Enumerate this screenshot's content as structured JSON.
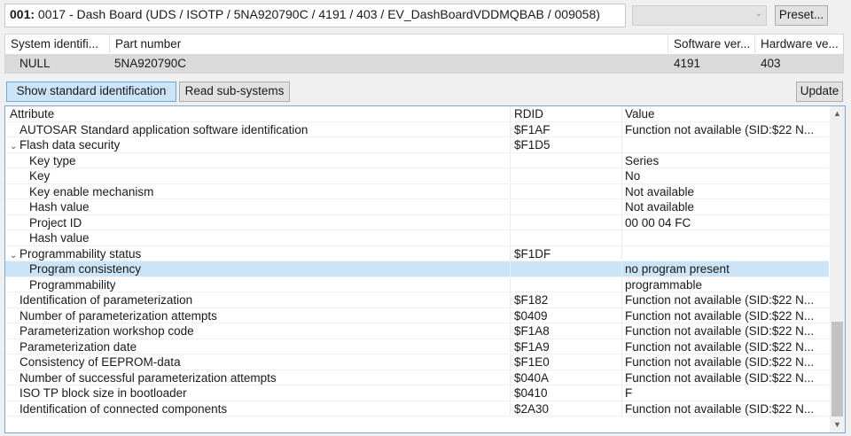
{
  "header": {
    "ecu_number": "001:",
    "ecu_title": " 0017 - Dash Board  (UDS / ISOTP / 5NA920790C / 4191 / 403 / EV_DashBoardVDDMQBAB / 009058)",
    "preset_label": "Preset..."
  },
  "ident_table": {
    "columns": [
      "System identifi...",
      "Part number",
      "Software ver...",
      "Hardware ve..."
    ],
    "row": [
      "NULL",
      "5NA920790C",
      "4191",
      "403"
    ]
  },
  "toolbar": {
    "show_standard_label": "Show standard identification",
    "read_subsystems_label": "Read sub-systems",
    "update_label": "Update"
  },
  "attributes": {
    "columns": [
      "Attribute",
      "RDID",
      "Value"
    ],
    "rows": [
      {
        "name": "AUTOSAR Standard application software identification",
        "rdid": "$F1AF",
        "value": "Function not available (SID:$22 N..."
      },
      {
        "name": "Flash data security",
        "rdid": "$F1D5",
        "value": ""
      },
      {
        "name": "Key type",
        "rdid": "",
        "value": "Series"
      },
      {
        "name": "Key",
        "rdid": "",
        "value": "No"
      },
      {
        "name": "Key enable mechanism",
        "rdid": "",
        "value": "Not available"
      },
      {
        "name": "Hash value",
        "rdid": "",
        "value": "Not available"
      },
      {
        "name": "Project ID",
        "rdid": "",
        "value": "00 00 04 FC"
      },
      {
        "name": "Hash value",
        "rdid": "",
        "value": ""
      },
      {
        "name": "Programmability status",
        "rdid": "$F1DF",
        "value": ""
      },
      {
        "name": "Program consistency",
        "rdid": "",
        "value": "no program present"
      },
      {
        "name": "Programmability",
        "rdid": "",
        "value": "programmable"
      },
      {
        "name": "Identification of parameterization",
        "rdid": "$F182",
        "value": "Function not available (SID:$22 N..."
      },
      {
        "name": "Number of parameterization attempts",
        "rdid": "$0409",
        "value": "Function not available (SID:$22 N..."
      },
      {
        "name": "Parameterization workshop code",
        "rdid": "$F1A8",
        "value": "Function not available (SID:$22 N..."
      },
      {
        "name": "Parameterization date",
        "rdid": "$F1A9",
        "value": "Function not available (SID:$22 N..."
      },
      {
        "name": "Consistency of EEPROM-data",
        "rdid": "$F1E0",
        "value": "Function not available (SID:$22 N..."
      },
      {
        "name": "Number of successful parameterization attempts",
        "rdid": "$040A",
        "value": "Function not available (SID:$22 N..."
      },
      {
        "name": "ISO TP block size in bootloader",
        "rdid": "$0410",
        "value": "F"
      },
      {
        "name": "Identification of connected components",
        "rdid": "$2A30",
        "value": "Function not available (SID:$22 N..."
      }
    ]
  },
  "icons": {
    "expand_chevron": "chevron-down-icon",
    "scroll_up": "chevron-up-icon",
    "scroll_down": "chevron-down-icon"
  }
}
